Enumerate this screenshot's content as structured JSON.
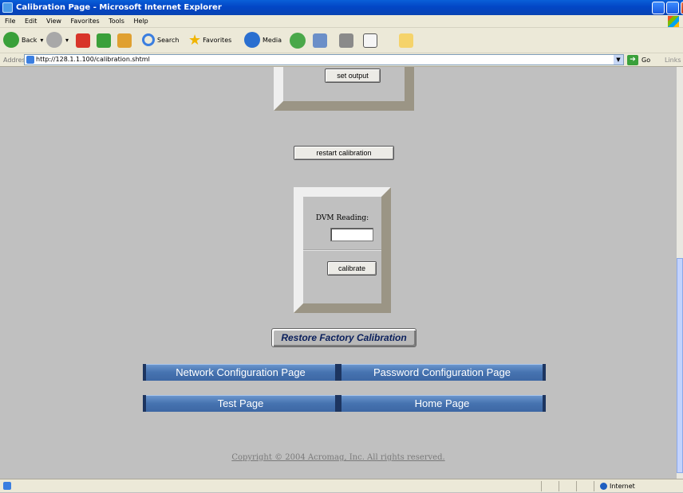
{
  "window": {
    "title": "Calibration Page - Microsoft Internet Explorer"
  },
  "menubar": {
    "items": [
      "File",
      "Edit",
      "View",
      "Favorites",
      "Tools",
      "Help"
    ]
  },
  "toolbar": {
    "back_label": "Back",
    "search_label": "Search",
    "favorites_label": "Favorites",
    "media_label": "Media"
  },
  "address": {
    "label": "Address",
    "url": "http://128.1.1.100/calibration.shtml",
    "go_label": "Go",
    "links_label": "Links"
  },
  "page": {
    "set_output_label": "set output",
    "restart_label": "restart calibration",
    "dvm_label": "DVM Reading:",
    "dvm_value": "",
    "calibrate_label": "calibrate",
    "restore_label": "Restore Factory Calibration",
    "nav": {
      "network": "Network Configuration Page",
      "password": "Password Configuration Page",
      "test": "Test Page",
      "home": "Home Page"
    },
    "copyright": "Copyright © 2004 Acromag, Inc. All rights reserved."
  },
  "statusbar": {
    "zone": "Internet"
  },
  "colors": {
    "page_background": "#c0c0c0",
    "nav_button": "#4673b0",
    "restore_text": "#0a1f5c"
  }
}
